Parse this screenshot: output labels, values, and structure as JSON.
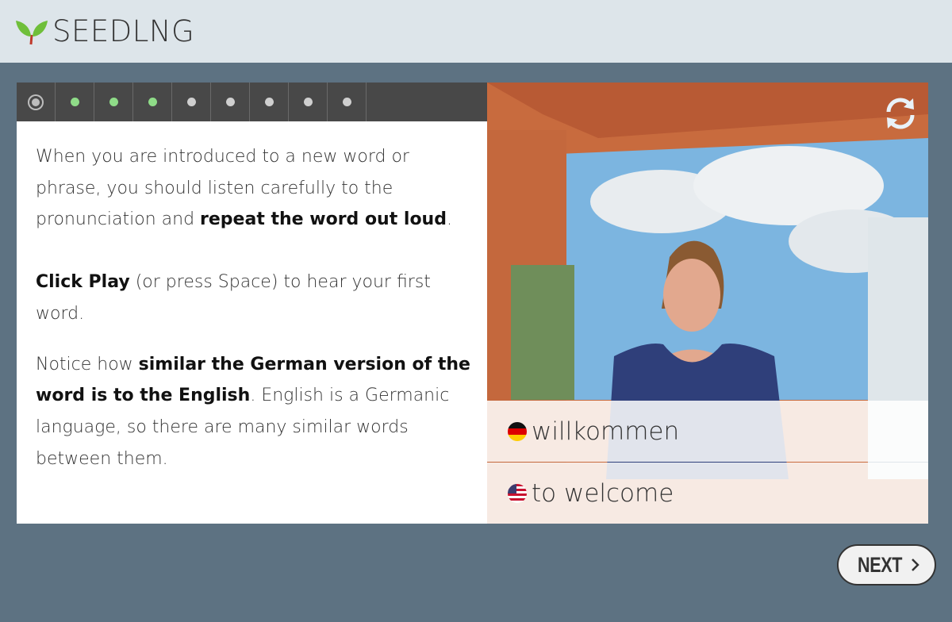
{
  "header": {
    "brand": "SEEDLNG"
  },
  "progress": {
    "steps": [
      "current",
      "done",
      "done",
      "done",
      "todo",
      "todo",
      "todo",
      "todo",
      "todo"
    ]
  },
  "lesson": {
    "p1_a": "When you are introduced to a new word or phrase, you should listen carefully to the pronunciation and ",
    "p1_b": "repeat the word out loud",
    "p1_c": ".",
    "p2_a": "Click Play",
    "p2_b": " (or press Space) to hear your first word.",
    "p3_a": "Notice how ",
    "p3_b": "similar the German version of the word is to the English",
    "p3_c": ".  English is a Germanic language, so there are many similar words between them."
  },
  "video": {
    "german_word": "willkommen",
    "english_word": "to welcome",
    "german_flag": "germany-flag-icon",
    "english_flag": "usa-flag-icon"
  },
  "footer": {
    "next_label": "NEXT"
  },
  "colors": {
    "page_bg": "#5d7282",
    "header_bg": "#dde5ea",
    "progress_bg": "#484848",
    "dot_done": "#8fdc88",
    "dot_todo": "#cfcfcf"
  }
}
